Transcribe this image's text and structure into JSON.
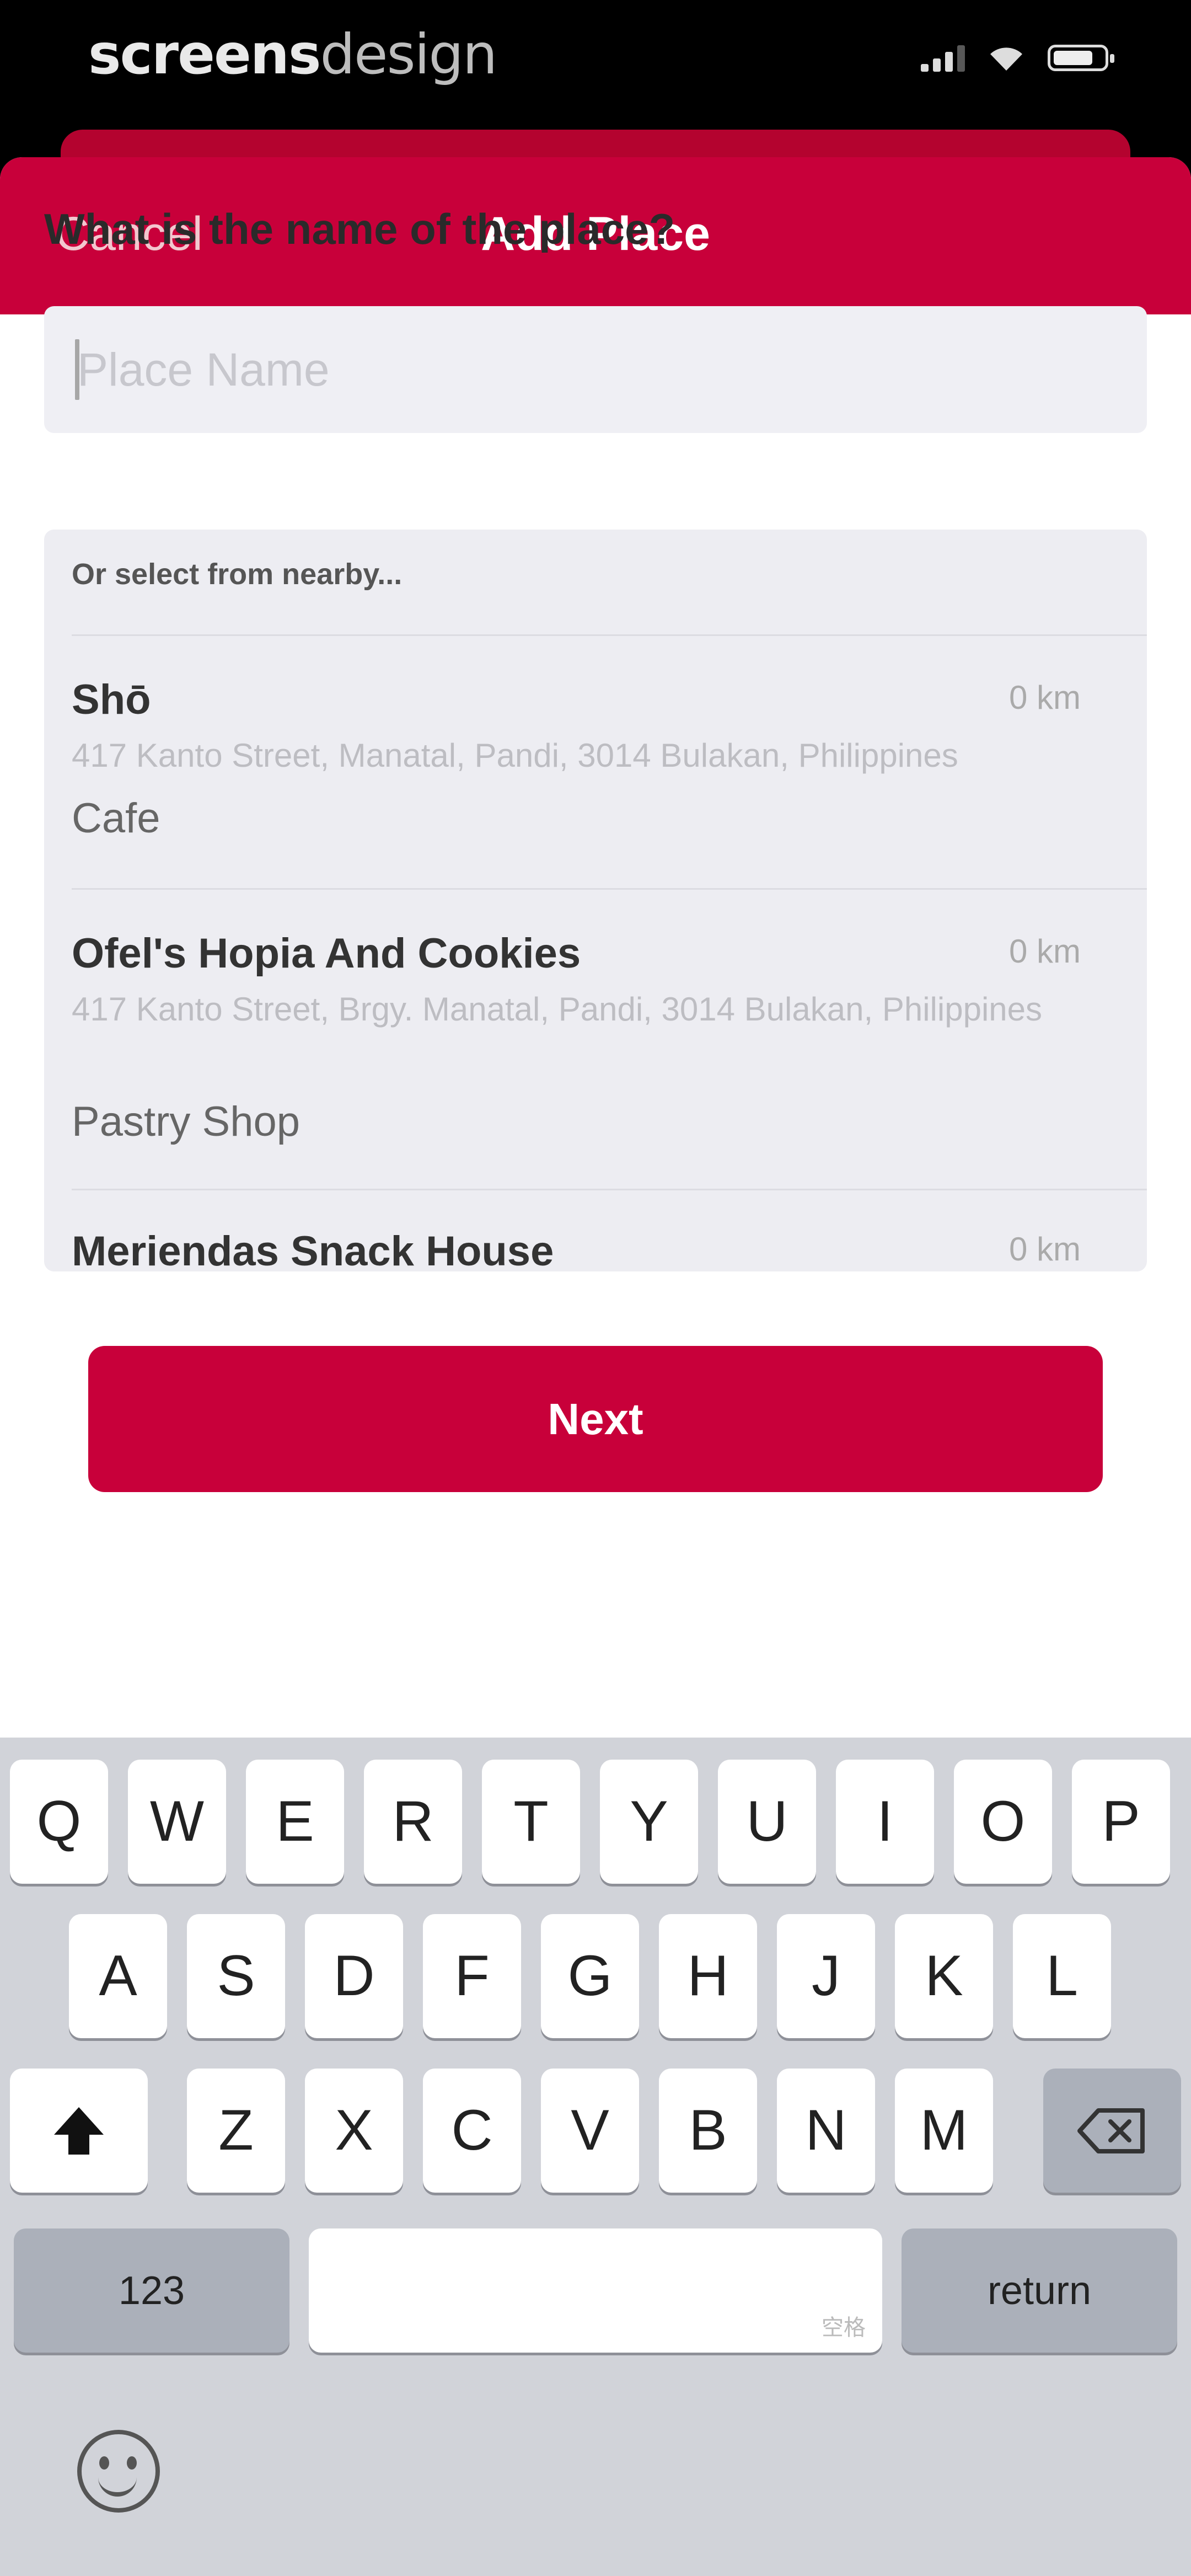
{
  "status_bar": {
    "brand_bold": "screens",
    "brand_light": "design"
  },
  "nav": {
    "cancel": "Cancel",
    "title": "Add Place"
  },
  "form": {
    "question": "What is the name of the place?",
    "name_placeholder": "Place Name",
    "name_value": ""
  },
  "nearby": {
    "header": "Or select from nearby...",
    "places": [
      {
        "name": "Shō",
        "distance": "0 km",
        "address": "417 Kanto Street, Manatal, Pandi, 3014 Bulakan, Philippines",
        "category": "Cafe"
      },
      {
        "name": "Ofel's Hopia And Cookies",
        "distance": "0 km",
        "address": "417 Kanto Street, Brgy. Manatal, Pandi, 3014 Bulakan, Philippines",
        "category": "Pastry Shop"
      },
      {
        "name": "Meriendas Snack House",
        "distance": "0 km"
      }
    ]
  },
  "next_button": "Next",
  "keyboard": {
    "row1": [
      "Q",
      "W",
      "E",
      "R",
      "T",
      "Y",
      "U",
      "I",
      "O",
      "P"
    ],
    "row2": [
      "A",
      "S",
      "D",
      "F",
      "G",
      "H",
      "J",
      "K",
      "L"
    ],
    "row3": [
      "Z",
      "X",
      "C",
      "V",
      "B",
      "N",
      "M"
    ],
    "numbers_key": "123",
    "space_hint": "空格",
    "return_key": "return",
    "shift_icon": "shift-icon",
    "delete_icon": "backspace-icon",
    "emoji_icon": "emoji-icon"
  },
  "colors": {
    "accent": "#c8003a",
    "keyboard_bg": "#d1d3d9"
  }
}
